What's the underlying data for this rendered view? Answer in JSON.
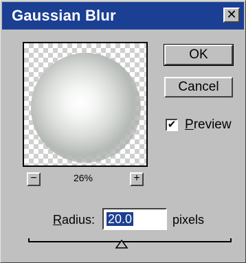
{
  "dialog": {
    "title": "Gaussian Blur",
    "close_glyph": "✕"
  },
  "preview_pane": {
    "zoom_level": "26%",
    "zoom_out_glyph": "−",
    "zoom_in_glyph": "+"
  },
  "buttons": {
    "ok_label": "OK",
    "cancel_label": "Cancel"
  },
  "preview_option": {
    "checked": true,
    "check_glyph": "✔",
    "label_first": "P",
    "label_rest": "review"
  },
  "radius": {
    "label_first": "R",
    "label_rest": "adius:",
    "value": "20.0",
    "units": "pixels",
    "slider_fraction": 0.46
  },
  "colors": {
    "titlebar": "#1b3f92",
    "dialog_bg": "#c0c0c0",
    "selection": "#1b3f92"
  },
  "icons": {
    "close": "close-icon",
    "zoom_out": "minus-icon",
    "zoom_in": "plus-icon",
    "slider": "triangle-slider-icon"
  }
}
